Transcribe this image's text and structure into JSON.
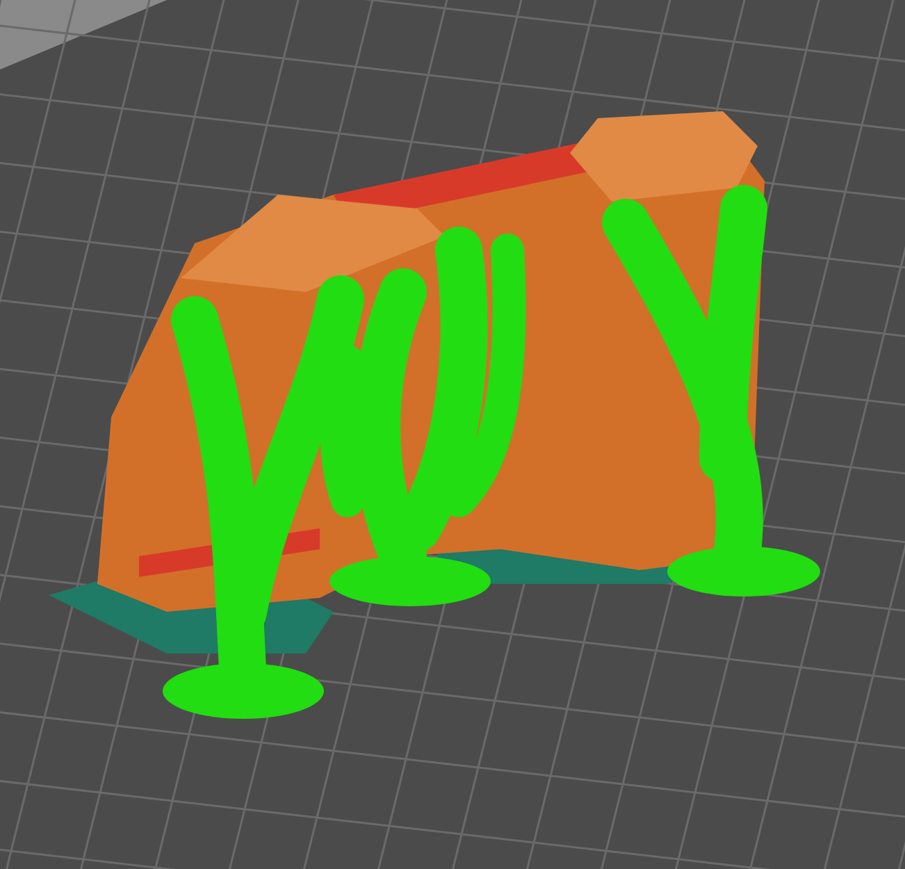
{
  "viewport": {
    "kind": "print-preview"
  }
}
